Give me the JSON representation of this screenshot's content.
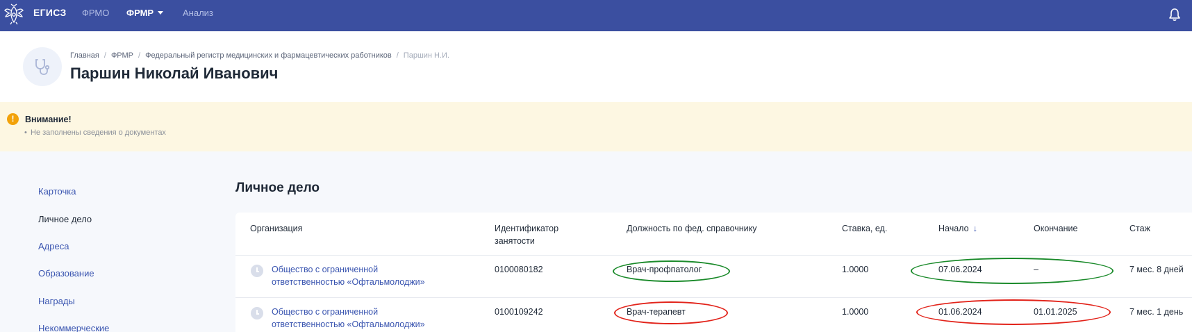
{
  "topbar": {
    "brand": "ЕГИСЗ",
    "nav": [
      {
        "label": "ФРМО",
        "active": false
      },
      {
        "label": "ФРМР",
        "active": true
      },
      {
        "label": "Анализ",
        "active": false
      }
    ],
    "colors": {
      "background": "#3b4fa0"
    }
  },
  "header": {
    "breadcrumb": [
      "Главная",
      "ФРМР",
      "Федеральный регистр медицинских и фармацевтических работников",
      "Паршин Н.И."
    ],
    "title": "Паршин Николай Иванович",
    "avatar_icon": "stethoscope-icon"
  },
  "alert": {
    "title": "Внимание!",
    "items": [
      "Не заполнены сведения о документах"
    ],
    "icon": "warning-icon",
    "colors": {
      "background": "#fdf7e2",
      "icon": "#f2a20a"
    }
  },
  "sidebar": {
    "items": [
      {
        "label": "Карточка",
        "active": false
      },
      {
        "label": "Личное дело",
        "active": true
      },
      {
        "label": "Адреса",
        "active": false
      },
      {
        "label": "Образование",
        "active": false
      },
      {
        "label": "Награды",
        "active": false
      },
      {
        "label": "Некоммерческие",
        "active": false
      }
    ]
  },
  "main": {
    "section_title": "Личное дело",
    "table": {
      "columns": [
        {
          "label": "Организация"
        },
        {
          "label": "Идентификатор\nзанятости"
        },
        {
          "label": "Должность по фед. справочнику"
        },
        {
          "label": "Ставка, ед."
        },
        {
          "label": "Начало",
          "sort": "↓"
        },
        {
          "label": "Окончание"
        },
        {
          "label": "Стаж"
        }
      ],
      "rows": [
        {
          "organization": "Общество с ограниченной\nответственностью «Офтальмолоджи»",
          "id": "0100080182",
          "position": "Врач-профпатолог",
          "rate": "1.0000",
          "start": "07.06.2024",
          "end": "–",
          "experience": "7 мес. 8 дней"
        },
        {
          "organization": "Общество с ограниченной\nответственностью «Офтальмолоджи»",
          "id": "0100109242",
          "position": "Врач-терапевт",
          "rate": "1.0000",
          "start": "01.06.2024",
          "end": "01.01.2025",
          "experience": "7 мес. 1 день"
        }
      ]
    }
  },
  "annotations": {
    "colors": {
      "green": "#1a8a2a",
      "red": "#e2231a"
    }
  }
}
